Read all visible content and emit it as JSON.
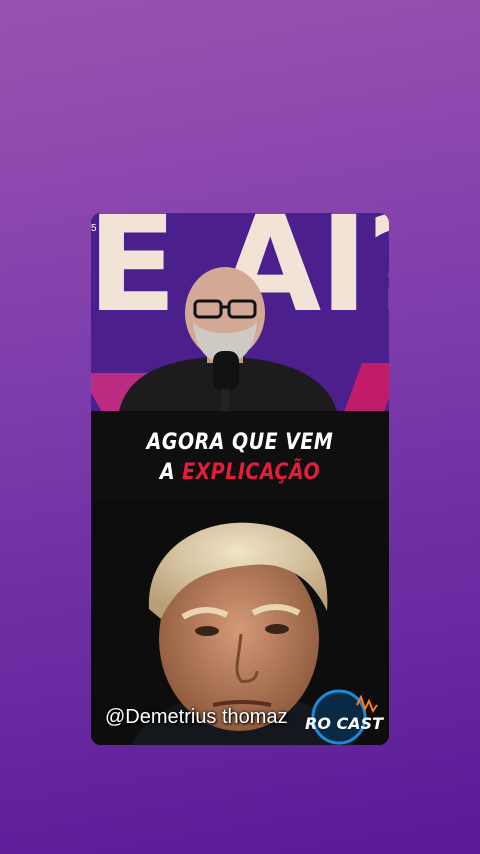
{
  "video": {
    "top_frame_text": "E AI?",
    "top_frame_small_mark": "5",
    "banner_line1": "AGORA QUE VEM",
    "banner_line2_prefix": "A",
    "banner_line2_highlight": "EXPLICAÇÃO",
    "handle": "@Demetrius thomaz",
    "logo_text": "RO CAST"
  },
  "colors": {
    "background_top": "#9a52b0",
    "background_bottom": "#5a1a97",
    "banner_accent": "#e41d3a",
    "studio_purple": "#4b1f8c"
  }
}
